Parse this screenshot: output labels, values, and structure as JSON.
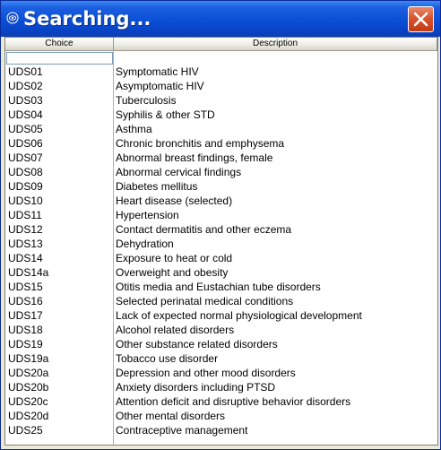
{
  "window": {
    "title": "Searching..."
  },
  "table": {
    "headers": {
      "choice": "Choice",
      "description": "Description"
    },
    "filter_value": "",
    "rows": [
      {
        "choice": "UDS01",
        "description": "Symptomatic HIV"
      },
      {
        "choice": "UDS02",
        "description": "Asymptomatic HIV"
      },
      {
        "choice": "UDS03",
        "description": "Tuberculosis"
      },
      {
        "choice": "UDS04",
        "description": "Syphilis & other STD"
      },
      {
        "choice": "UDS05",
        "description": "Asthma"
      },
      {
        "choice": "UDS06",
        "description": "Chronic bronchitis and emphysema"
      },
      {
        "choice": "UDS07",
        "description": "Abnormal breast findings, female"
      },
      {
        "choice": "UDS08",
        "description": "Abnormal cervical findings"
      },
      {
        "choice": "UDS09",
        "description": "Diabetes mellitus"
      },
      {
        "choice": "UDS10",
        "description": "Heart disease (selected)"
      },
      {
        "choice": "UDS11",
        "description": "Hypertension"
      },
      {
        "choice": "UDS12",
        "description": "Contact dermatitis and other eczema"
      },
      {
        "choice": "UDS13",
        "description": "Dehydration"
      },
      {
        "choice": "UDS14",
        "description": "Exposure to heat or cold"
      },
      {
        "choice": "UDS14a",
        "description": "Overweight and obesity"
      },
      {
        "choice": "UDS15",
        "description": "Otitis media and Eustachian tube disorders"
      },
      {
        "choice": "UDS16",
        "description": "Selected perinatal medical conditions"
      },
      {
        "choice": "UDS17",
        "description": "Lack of expected normal physiological development"
      },
      {
        "choice": "UDS18",
        "description": "Alcohol related disorders"
      },
      {
        "choice": "UDS19",
        "description": "Other substance related disorders"
      },
      {
        "choice": "UDS19a",
        "description": "Tobacco use disorder"
      },
      {
        "choice": "UDS20a",
        "description": "Depression and other mood disorders"
      },
      {
        "choice": "UDS20b",
        "description": "Anxiety disorders including PTSD"
      },
      {
        "choice": "UDS20c",
        "description": "Attention deficit and disruptive behavior disorders"
      },
      {
        "choice": "UDS20d",
        "description": "Other mental disorders"
      },
      {
        "choice": "UDS25",
        "description": "Contraceptive management"
      }
    ]
  }
}
